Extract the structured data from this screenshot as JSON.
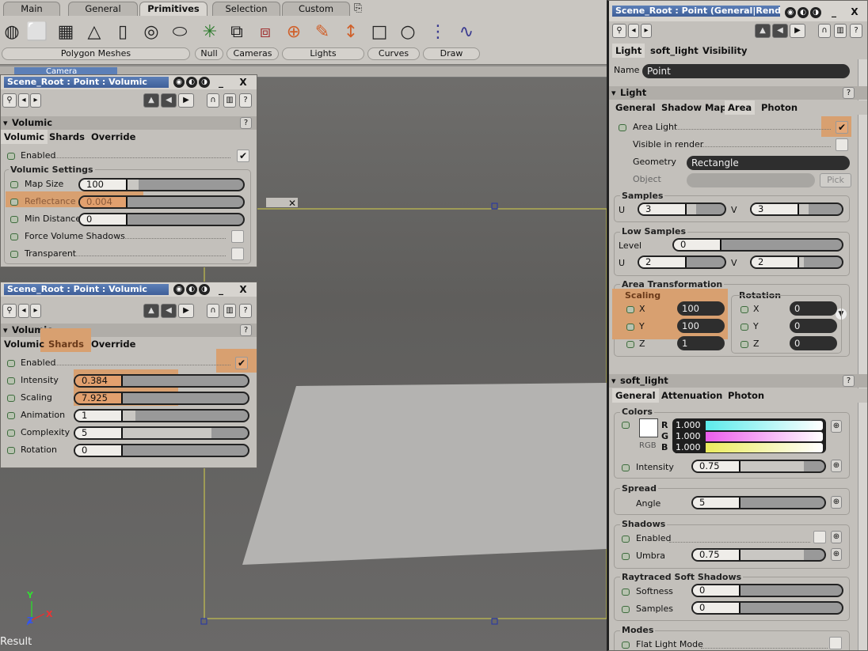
{
  "toptabs": [
    "Main",
    "General",
    "Primitives",
    "Selection",
    "Custom"
  ],
  "toolgroups": [
    "Polygon Meshes",
    "Null",
    "Cameras",
    "Lights",
    "Curves",
    "Draw"
  ],
  "viewport": {
    "camera_label": "Camera",
    "axis_y": "Y",
    "axis_z": "Z",
    "axis_x": "X",
    "status": "Result"
  },
  "panel1": {
    "title": "Scene_Root : Point : Volumic",
    "section": "Volumic",
    "tabs": [
      "Volumic",
      "Shards",
      "Override"
    ],
    "enabled_label": "Enabled",
    "group_label": "Volumic Settings",
    "rows": [
      {
        "label": "Map Size",
        "value": "100"
      },
      {
        "label": "Reflectance",
        "value": "0.004"
      },
      {
        "label": "Min Distance",
        "value": "0"
      }
    ],
    "force_label": "Force Volume Shadows",
    "transparent_label": "Transparent"
  },
  "panel2": {
    "title": "Scene_Root : Point : Volumic",
    "section": "Volumic",
    "tabs": [
      "Volumic",
      "Shards",
      "Override"
    ],
    "enabled_label": "Enabled",
    "rows": [
      {
        "label": "Intensity",
        "value": "0.384"
      },
      {
        "label": "Scaling",
        "value": "7.925"
      },
      {
        "label": "Animation",
        "value": "1"
      },
      {
        "label": "Complexity",
        "value": "5"
      },
      {
        "label": "Rotation",
        "value": "0"
      }
    ]
  },
  "right": {
    "title": "Scene_Root : Point (General|Rend...",
    "tabs": [
      "Light",
      "soft_light",
      "Visibility"
    ],
    "name_label": "Name",
    "name_value": "Point",
    "light_section": "Light",
    "light_tabs": [
      "General",
      "Shadow Map",
      "Area",
      "Photon"
    ],
    "area_light_label": "Area Light",
    "visible_label": "Visible in render",
    "geometry_label": "Geometry",
    "geometry_value": "Rectangle",
    "object_label": "Object",
    "pick_label": "Pick",
    "samples_label": "Samples",
    "samples_u": "3",
    "samples_v": "3",
    "low_samples_label": "Low Samples",
    "level_label": "Level",
    "level_value": "0",
    "low_u": "2",
    "low_v": "2",
    "u_label": "U",
    "v_label": "V",
    "area_transform_label": "Area Transformation",
    "scaling_label": "Scaling",
    "rotation_label": "Rotation",
    "scale_x": "100",
    "scale_y": "100",
    "scale_z": "1",
    "rot_x": "0",
    "rot_y": "0",
    "rot_z": "0",
    "x_label": "X",
    "y_label": "Y",
    "z_label": "Z",
    "soft_section": "soft_light",
    "soft_tabs": [
      "General",
      "Attenuation",
      "Photon"
    ],
    "colors_label": "Colors",
    "rgb_label": "RGB",
    "r_label": "R",
    "g_label": "G",
    "b_label": "B",
    "r_value": "1.000",
    "g_value": "1.000",
    "b_value": "1.000",
    "intensity_label": "Intensity",
    "intensity_value": "0.75",
    "spread_label": "Spread",
    "angle_label": "Angle",
    "angle_value": "5",
    "shadows_label": "Shadows",
    "enabled_label": "Enabled",
    "umbra_label": "Umbra",
    "umbra_value": "0.75",
    "rt_label": "Raytraced Soft Shadows",
    "softness_label": "Softness",
    "softness_value": "0",
    "samples2_label": "Samples",
    "samples2_value": "0",
    "modes_label": "Modes",
    "flat_label": "Flat Light Mode"
  }
}
